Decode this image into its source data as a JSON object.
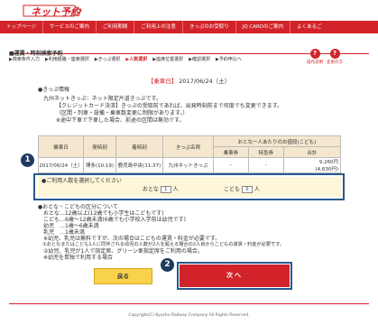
{
  "header": {
    "logo": "ネット予約",
    "nav": [
      "トップページ",
      "サービスのご案内",
      "ご利用期間",
      "ご利用上の注意",
      "きっぷのお受取り",
      "JQ CARDのご案内",
      "よくあるご"
    ]
  },
  "page_title": "■運賃・時刻検索予約",
  "steps": [
    "▶検索条件入力",
    "▶利用経路・座席選択",
    "▶きっぷ選択",
    "▶人数選択",
    "▶座席位置選択",
    "▶確認選択",
    "▶予約申込へ"
  ],
  "active_step_index": 3,
  "help": [
    {
      "mark": "?",
      "label": "操作説明"
    },
    {
      "mark": "?",
      "label": "変更の方"
    }
  ],
  "ride_date": {
    "label": "【乗車日】",
    "value": "2017/06/24（土）"
  },
  "ticket_info": {
    "heading": "●きっぷ情報",
    "name": "九州ネットきっぷ：ネット限定片道きっぷです。",
    "lines": [
      "【クレジットカード決済】きっぷの受取前であれば、出発時刻前まで何度でも変更できます。",
      "（区間・列車・設備・乗車数変更に制限があります。）",
      "※途中下車で下車した場合、前途の区間は無効です。"
    ]
  },
  "table": {
    "headers": [
      "乗車日",
      "発時刻",
      "着時刻",
      "きっぷ名称",
      "おとな一人あたりのお値段(こども)"
    ],
    "subheaders": [
      "乗車券",
      "特急券",
      "合計"
    ],
    "rows": [
      {
        "date": "2017/06/24（土）",
        "dep": "博多(10:19)",
        "arr": "鹿児島中央(11:37)",
        "ticket": "九州ネットきっぷ",
        "fare": "-",
        "express": "-",
        "total": "9,260円",
        "total_child": "(4,630円)"
      }
    ]
  },
  "select": {
    "badge": "1",
    "prompt": "●ご利用人数を選択してください",
    "adult_label": "おとな",
    "adult_value": "1",
    "adult_unit": "人",
    "child_label": "こども",
    "child_value": "0",
    "child_unit": "人"
  },
  "notes": [
    "●おとな・こどもの区分について",
    "　おとな…12歳以上(12歳でも小学生はこどもです)",
    "　こども…6歳～12歳未満(6歳でも小学校入学前は幼児です)",
    "　幼児　…1歳～6歳未満",
    "　乳児　…1歳未満",
    "　※幼児、乳児は無料ですが、次の場合はこどもの運賃・料金が必要です。",
    "　①おとなまたはこども1人に同伴される幼児の人数が2人を超える場合の2人目からこどもの運賃・料金が必要です。",
    "　②幼児、乳児が1人で指定席、グリーン車指定席をご利用の場合。",
    "　※幼児を単独で利用する場合"
  ],
  "buttons": {
    "back": "戻る",
    "next": "次へ",
    "badge2": "2"
  },
  "footer": "Copyright(C) Kyushu Railway Company All Rights Reserved."
}
